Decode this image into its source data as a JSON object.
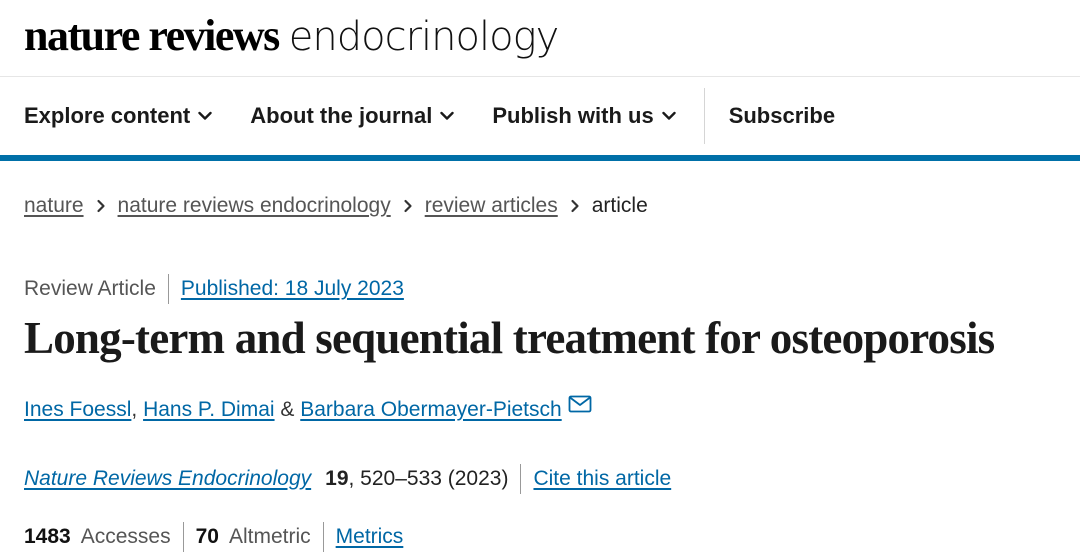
{
  "masthead": {
    "brand_bold": "nature reviews",
    "brand_light": "endocrinology"
  },
  "nav": {
    "items": [
      {
        "label": "Explore content",
        "icon": "chevron-down-icon"
      },
      {
        "label": "About the journal",
        "icon": "chevron-down-icon"
      },
      {
        "label": "Publish with us",
        "icon": "chevron-down-icon"
      }
    ],
    "subscribe": "Subscribe"
  },
  "breadcrumb": {
    "items": [
      "nature",
      "nature reviews endocrinology",
      "review articles"
    ],
    "current": "article"
  },
  "article": {
    "type": "Review Article",
    "published": "Published: 18 July 2023",
    "title": "Long-term and sequential treatment for osteoporosis",
    "authors": [
      "Ines Foessl",
      "Hans P. Dimai",
      "Barbara Obermayer-Pietsch"
    ],
    "author_separators": [
      ", ",
      " & "
    ],
    "citation": {
      "journal": "Nature Reviews Endocrinology",
      "volume": "19",
      "pages_year": ", 520–533 (2023)",
      "cite_label": "Cite this article"
    },
    "metrics": {
      "accesses_count": "1483",
      "accesses_label": "Accesses",
      "altmetric_count": "70",
      "altmetric_label": "Altmetric",
      "metrics_link": "Metrics"
    }
  },
  "colors": {
    "accent_blue": "#0070a8",
    "link_blue": "#0067a5"
  }
}
